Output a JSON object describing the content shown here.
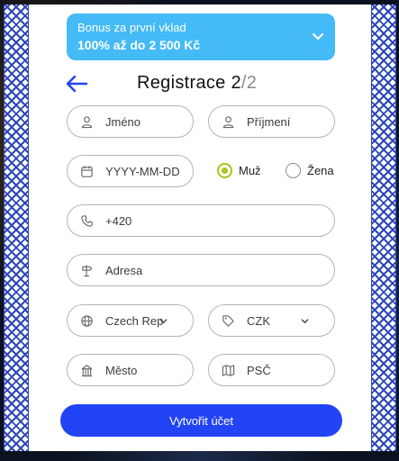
{
  "bonus": {
    "line1": "Bonus za první vklad",
    "line2": "100% až do 2 500 Kč"
  },
  "header": {
    "title_main": "Registrace 2",
    "title_muted": "/2"
  },
  "form": {
    "first_name": "Jméno",
    "last_name": "Příjmení",
    "birthdate": "YYYY-MM-DD",
    "gender_male": "Muž",
    "gender_female": "Žena",
    "gender_selected": "Muž",
    "phone": "+420",
    "address": "Adresa",
    "country": "Czech Rep",
    "currency": "CZK",
    "city": "Město",
    "zip": "PSČ"
  },
  "submit_label": "Vytvořit účet",
  "colors": {
    "bonus_bg": "#44baf7",
    "accent": "#2244f5",
    "radio_checked": "#a6c51a",
    "ornament": "#2c47b8"
  },
  "icons": [
    "chevron-down-icon",
    "back-arrow-icon",
    "user-icon",
    "calendar-icon",
    "phone-icon",
    "signpost-icon",
    "globe-icon",
    "tag-icon",
    "building-icon",
    "map-icon"
  ]
}
